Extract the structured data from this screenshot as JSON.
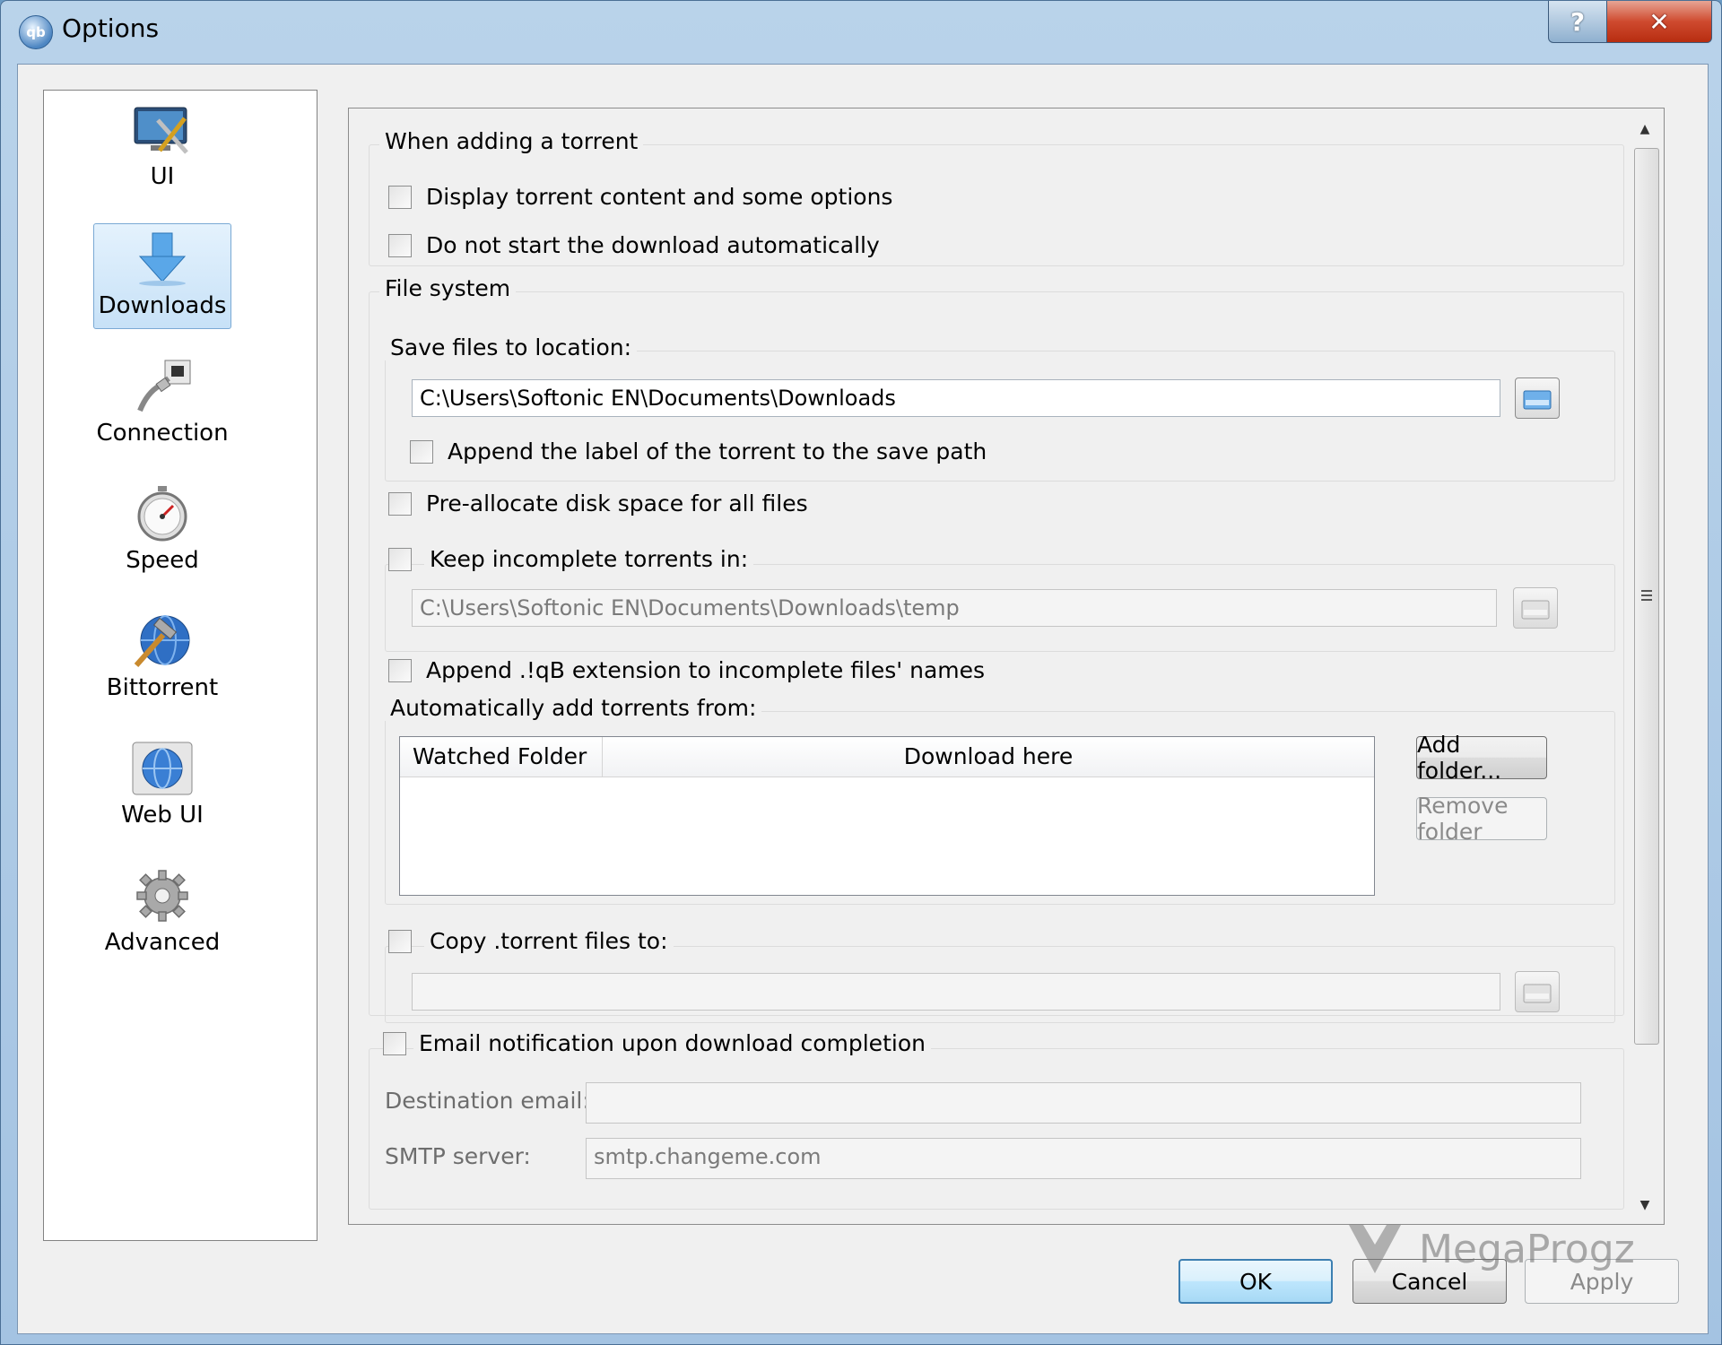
{
  "window": {
    "title": "Options",
    "app_icon_text": "qb"
  },
  "sidebar": {
    "items": [
      {
        "label": "UI",
        "icon": "monitor-tools-icon"
      },
      {
        "label": "Downloads",
        "icon": "download-arrow-icon",
        "selected": true
      },
      {
        "label": "Connection",
        "icon": "network-plug-icon"
      },
      {
        "label": "Speed",
        "icon": "stopwatch-icon"
      },
      {
        "label": "Bittorrent",
        "icon": "globe-hammer-icon"
      },
      {
        "label": "Web UI",
        "icon": "web-globe-icon"
      },
      {
        "label": "Advanced",
        "icon": "gear-icon"
      }
    ]
  },
  "adding": {
    "title": "When adding a torrent",
    "display_content": "Display torrent content and some options",
    "no_autostart": "Do not start the download automatically"
  },
  "filesystem": {
    "title": "File system",
    "save_location_label": "Save files to location:",
    "save_path": "C:\\Users\\Softonic EN\\Documents\\Downloads",
    "append_label": "Append the label of the torrent to the save path",
    "preallocate": "Pre-allocate disk space for all files",
    "keep_incomplete": "Keep incomplete torrents in:",
    "temp_path": "C:\\Users\\Softonic EN\\Documents\\Downloads\\temp",
    "append_ext": "Append .!qB extension to incomplete files' names",
    "auto_add_label": "Automatically add torrents from:",
    "columns": [
      "Watched Folder",
      "Download here"
    ],
    "add_folder": "Add folder...",
    "remove_folder": "Remove folder",
    "copy_torrent": "Copy .torrent files to:",
    "copy_path": ""
  },
  "email": {
    "title": "Email notification upon download completion",
    "dest_label": "Destination email:",
    "dest_value": "",
    "smtp_label": "SMTP server:",
    "smtp_value": "smtp.changeme.com"
  },
  "footer": {
    "ok": "OK",
    "cancel": "Cancel",
    "apply": "Apply"
  },
  "watermark": {
    "text": "MegaProgz"
  }
}
